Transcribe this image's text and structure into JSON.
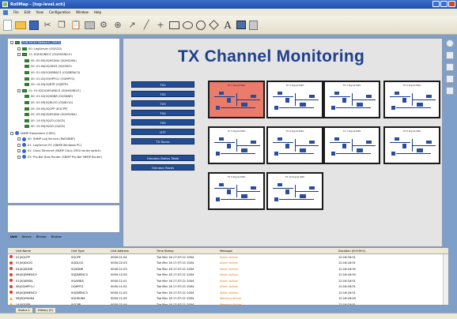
{
  "window": {
    "title": "RollMap - [top-level.sch]"
  },
  "menu": [
    "File",
    "Edit",
    "View",
    "Configuration",
    "Window",
    "Help"
  ],
  "toolbar_icons": [
    "new-document-icon",
    "open-folder-icon",
    "save-icon",
    "cut-icon",
    "copy-icon",
    "paste-icon",
    "print-icon",
    "settings-icon",
    "zoom-icon",
    "pointer-icon",
    "line-icon",
    "cross-icon",
    "rectangle-icon",
    "oval-icon",
    "circle-icon",
    "diamond-icon",
    "text-icon",
    "image-icon",
    "disk-icon"
  ],
  "tree": {
    "items": [
      {
        "label": "TVB-TxCtrl Network (3000)",
        "level": 0,
        "kind": "net",
        "selected": true
      },
      {
        "label": "00: LogServer (OQSCD)",
        "level": 1,
        "kind": "dev"
      },
      {
        "label": "11: 0QHSUND-E (OQHSUND-E)",
        "level": 1,
        "kind": "net"
      },
      {
        "label": "00: 00:05|0QHSUN4 (0QHSUN4)",
        "level": 2,
        "kind": "dev"
      },
      {
        "label": "00: 01:04|0QCB03 (0QCB03)",
        "level": 2,
        "kind": "dev"
      },
      {
        "label": "00: 01:03|OQSBRAC3 (OQSBRAC3)",
        "level": 2,
        "kind": "dev"
      },
      {
        "label": "00: 01:02|OQHPFG-I (OQHPFG)",
        "level": 2,
        "kind": "dev"
      },
      {
        "label": "00: 14:03|0QBTR (0QBTR)",
        "level": 2,
        "kind": "dev"
      },
      {
        "label": "21: 01:02|0QHSUND-E (0QHSUND-E)",
        "level": 1,
        "kind": "net"
      },
      {
        "label": "00: 01:02|0QSDNR (0QSDNR)",
        "level": 2,
        "kind": "dev"
      },
      {
        "label": "00: 02:03|0QDLOG (0QDLOG)",
        "level": 2,
        "kind": "dev"
      },
      {
        "label": "00: 04:05|0QCPP (0QCPP)",
        "level": 2,
        "kind": "dev"
      },
      {
        "label": "00: 09:04|0QHSUN4 (0QHSUN4)",
        "level": 2,
        "kind": "dev"
      },
      {
        "label": "00: 14:03|0QCD (0QCD)",
        "level": 2,
        "kind": "dev"
      },
      {
        "label": "00: 15:03|0QCD (0QCD)",
        "level": 2,
        "kind": "dev"
      },
      {
        "label": "SNMP Equipment (1000)",
        "level": 0,
        "kind": "snmp"
      },
      {
        "label": "00: SNMP Log Service (RollSNMP)",
        "level": 1,
        "kind": "snmp"
      },
      {
        "label": "01: LogServer PC (SNMP Windows PC)",
        "level": 1,
        "kind": "snmp"
      },
      {
        "label": "02: Cisco Ethernet (SNMP Cisco 2950 series switch)",
        "level": 1,
        "kind": "snmp"
      },
      {
        "label": "03: Pro-Bel Halo Router (SNMP Pro-Bel SNMP Router)",
        "level": 1,
        "kind": "snmp"
      }
    ]
  },
  "left_tabs": [
    "Unit",
    "Device",
    "Bitmap",
    "Browse"
  ],
  "diagram": {
    "title": "TX Channel Monitoring",
    "channel_buttons": [
      "TX1",
      "TX2",
      "TX3",
      "TX4",
      "TX5",
      "DTT",
      "TX Racks"
    ],
    "extra_buttons": [
      "Omneon Status Table",
      "Omneon Racks"
    ],
    "panels": [
      {
        "label": "TX 1 Signal Path",
        "alarm": true
      },
      {
        "label": "TX 2 Signal Path",
        "alarm": false
      },
      {
        "label": "TX 3 Signal Path",
        "alarm": false
      },
      {
        "label": "TX 4 Signal Path",
        "alarm": false
      },
      {
        "label": "TX 5 Signal Path",
        "alarm": false
      },
      {
        "label": "TX 6 Signal Path",
        "alarm": false
      },
      {
        "label": "TX 7 Signal Path",
        "alarm": false
      },
      {
        "label": "TX 8 Signal Path",
        "alarm": false
      },
      {
        "label": "TX 9 Signal Path",
        "alarm": false
      },
      {
        "label": "TX 10 Signal Path",
        "alarm": false
      }
    ]
  },
  "log_table": {
    "headers": [
      "",
      "Unit Name",
      "Unit Type",
      "Unit Address",
      "Time Stamp",
      "Message",
      "Duration (D:H:M:S)"
    ],
    "rows": [
      {
        "kind": "alarm",
        "unit": "01|0QCPP",
        "type": "0QCPP",
        "addr": "0000:21:04",
        "time": "Tue Mar 16 17:57:21 2004",
        "msg": "Alarm Active",
        "dur": "12:16:18:51"
      },
      {
        "kind": "alarm",
        "unit": "01|0QDLOG",
        "type": "0QDLOG",
        "addr": "0000:22:03",
        "time": "Tue Mar 16 17:57:21 2004",
        "msg": "Alarm Active",
        "dur": "12:16:18:51"
      },
      {
        "kind": "alarm",
        "unit": "04|0QSDNR",
        "type": "0QSDNR",
        "addr": "0000:21:03",
        "time": "Tue Mar 16 17:57:21 2004",
        "msg": "Alarm Active",
        "dur": "12:16:18:50"
      },
      {
        "kind": "alarm",
        "unit": "06|0QDMENC3",
        "type": "0QDMENC3",
        "addr": "0000:12:03",
        "time": "Tue Mar 16 17:57:21 2004",
        "msg": "Alarm Active",
        "dur": "12:16:18:50"
      },
      {
        "kind": "alarm",
        "unit": "01|0QAMDA",
        "type": "0QAMDA",
        "addr": "0000:11:01",
        "time": "Tue Mar 16 17:57:21 2004",
        "msg": "Alarm Active",
        "dur": "12:16:18:51"
      },
      {
        "kind": "alarm",
        "unit": "06|OQHPFG-I",
        "type": "OQHPFG",
        "addr": "0000:11:02",
        "time": "Tue Mar 16 17:57:21 2004",
        "msg": "Alarm Active",
        "dur": "12:16:18:51"
      },
      {
        "kind": "alarm",
        "unit": "08|0QDMENC3",
        "type": "0QDMENC3",
        "addr": "0000:11:03",
        "time": "Tue Mar 16 17:57:21 2004",
        "msg": "Alarm Active",
        "dur": "12:16:18:51"
      },
      {
        "kind": "warn",
        "unit": "06|0QHSUN4",
        "type": "0QHSUN4",
        "addr": "0000:11:05",
        "time": "Tue Mar 16 17:57:21 2004",
        "msg": "Warning Active",
        "dur": "12:16:18:49"
      },
      {
        "kind": "warn",
        "unit": "14|0QCPP",
        "type": "0QCPP",
        "addr": "0000:21:04",
        "time": "Tue Mar 16 17:57:21 2004",
        "msg": "Warning Active",
        "dur": "12:16:18:51"
      }
    ]
  },
  "bottom_tabs": [
    "Status 1",
    "History (0)"
  ]
}
